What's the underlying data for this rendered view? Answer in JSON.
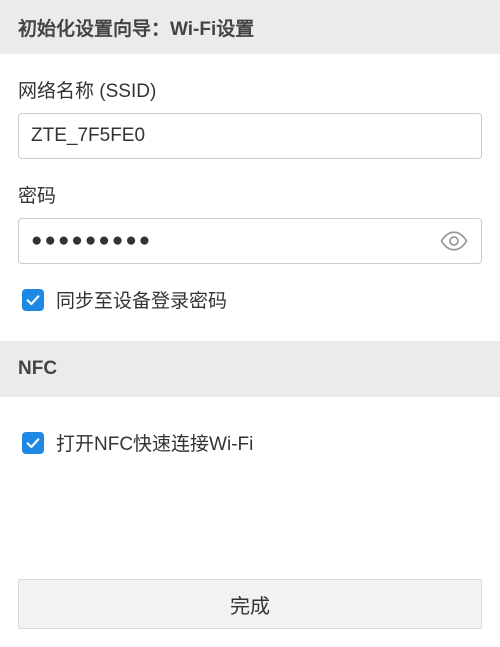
{
  "header": {
    "title": "初始化设置向导：Wi-Fi设置"
  },
  "wifi": {
    "ssid_label": "网络名称 (SSID)",
    "ssid_value": "ZTE_7F5FE0",
    "password_label": "密码",
    "password_value": "●●●●●●●●●",
    "sync_checked": true,
    "sync_label": "同步至设备登录密码"
  },
  "nfc": {
    "header": "NFC",
    "enable_checked": true,
    "enable_label": "打开NFC快速连接Wi-Fi"
  },
  "footer": {
    "done_label": "完成"
  },
  "icons": {
    "eye": "eye-icon",
    "checkmark": "checkmark-icon"
  },
  "colors": {
    "accent": "#1e88e5",
    "header_bg": "#ebebeb",
    "border": "#cccccc",
    "button_bg": "#f2f2f2"
  }
}
